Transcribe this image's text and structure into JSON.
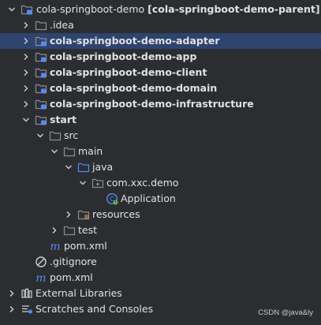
{
  "tree": {
    "root": {
      "label": "cola-springboot-demo",
      "suffix": "[cola-springboot-demo-parent]"
    },
    "idea": "idea",
    "adapter": "cola-springboot-demo-adapter",
    "app": "cola-springboot-demo-app",
    "client": "cola-springboot-demo-client",
    "domain": "cola-springboot-demo-domain",
    "infrastructure": "cola-springboot-demo-infrastructure",
    "start": "start",
    "src": "src",
    "main": "main",
    "java": "java",
    "package": "com.xxc.demo",
    "application": "Application",
    "resources": "resources",
    "test": "test",
    "start_pom": "pom.xml",
    "gitignore": "gitignore",
    "root_pom": "pom.xml",
    "external_libraries": "External Libraries",
    "scratches": "Scratches and Consoles"
  },
  "watermark": "CSDN @java&ly",
  "colors": {
    "background": "#2b2d30",
    "selection": "#2e436e",
    "hover": "#393b40",
    "folder": "#8a8d93",
    "module_badge": "#548af7",
    "java_folder": "#548af7",
    "maven": "#548af7"
  }
}
